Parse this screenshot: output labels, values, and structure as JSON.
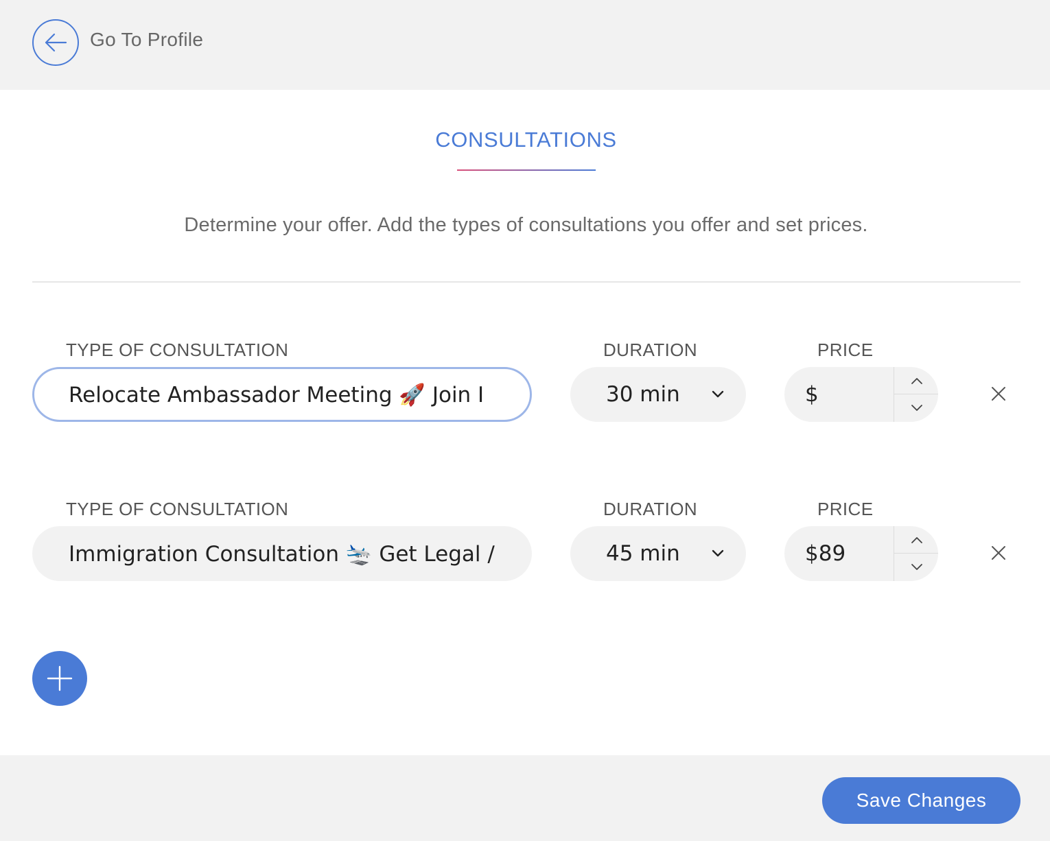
{
  "header": {
    "back_label": "Go To Profile"
  },
  "section": {
    "title": "CONSULTATIONS",
    "subtitle": "Determine your offer. Add the types of consultations you offer and set prices."
  },
  "consultations": [
    {
      "type_label": "TYPE OF CONSULTATION",
      "type_value": "Relocate Ambassador Meeting 🚀 Join I",
      "duration_label": "DURATION",
      "duration_value": "30 min",
      "price_label": "PRICE",
      "price_value": "$"
    },
    {
      "type_label": "TYPE OF CONSULTATION",
      "type_value": "Immigration Consultation 🛬 Get Legal /",
      "duration_label": "DURATION",
      "duration_value": "45 min",
      "price_label": "PRICE",
      "price_value": "$89"
    }
  ],
  "footer": {
    "save_label": "Save Changes"
  },
  "colors": {
    "accent": "#4a7bd6",
    "underline_start": "#d9507a",
    "panel_bg": "#f2f2f2"
  },
  "icons": {
    "back": "arrow-left-icon",
    "dropdown": "chevron-down-icon",
    "step_up": "chevron-up-icon",
    "step_down": "chevron-down-icon",
    "remove": "close-icon",
    "add": "plus-icon"
  }
}
